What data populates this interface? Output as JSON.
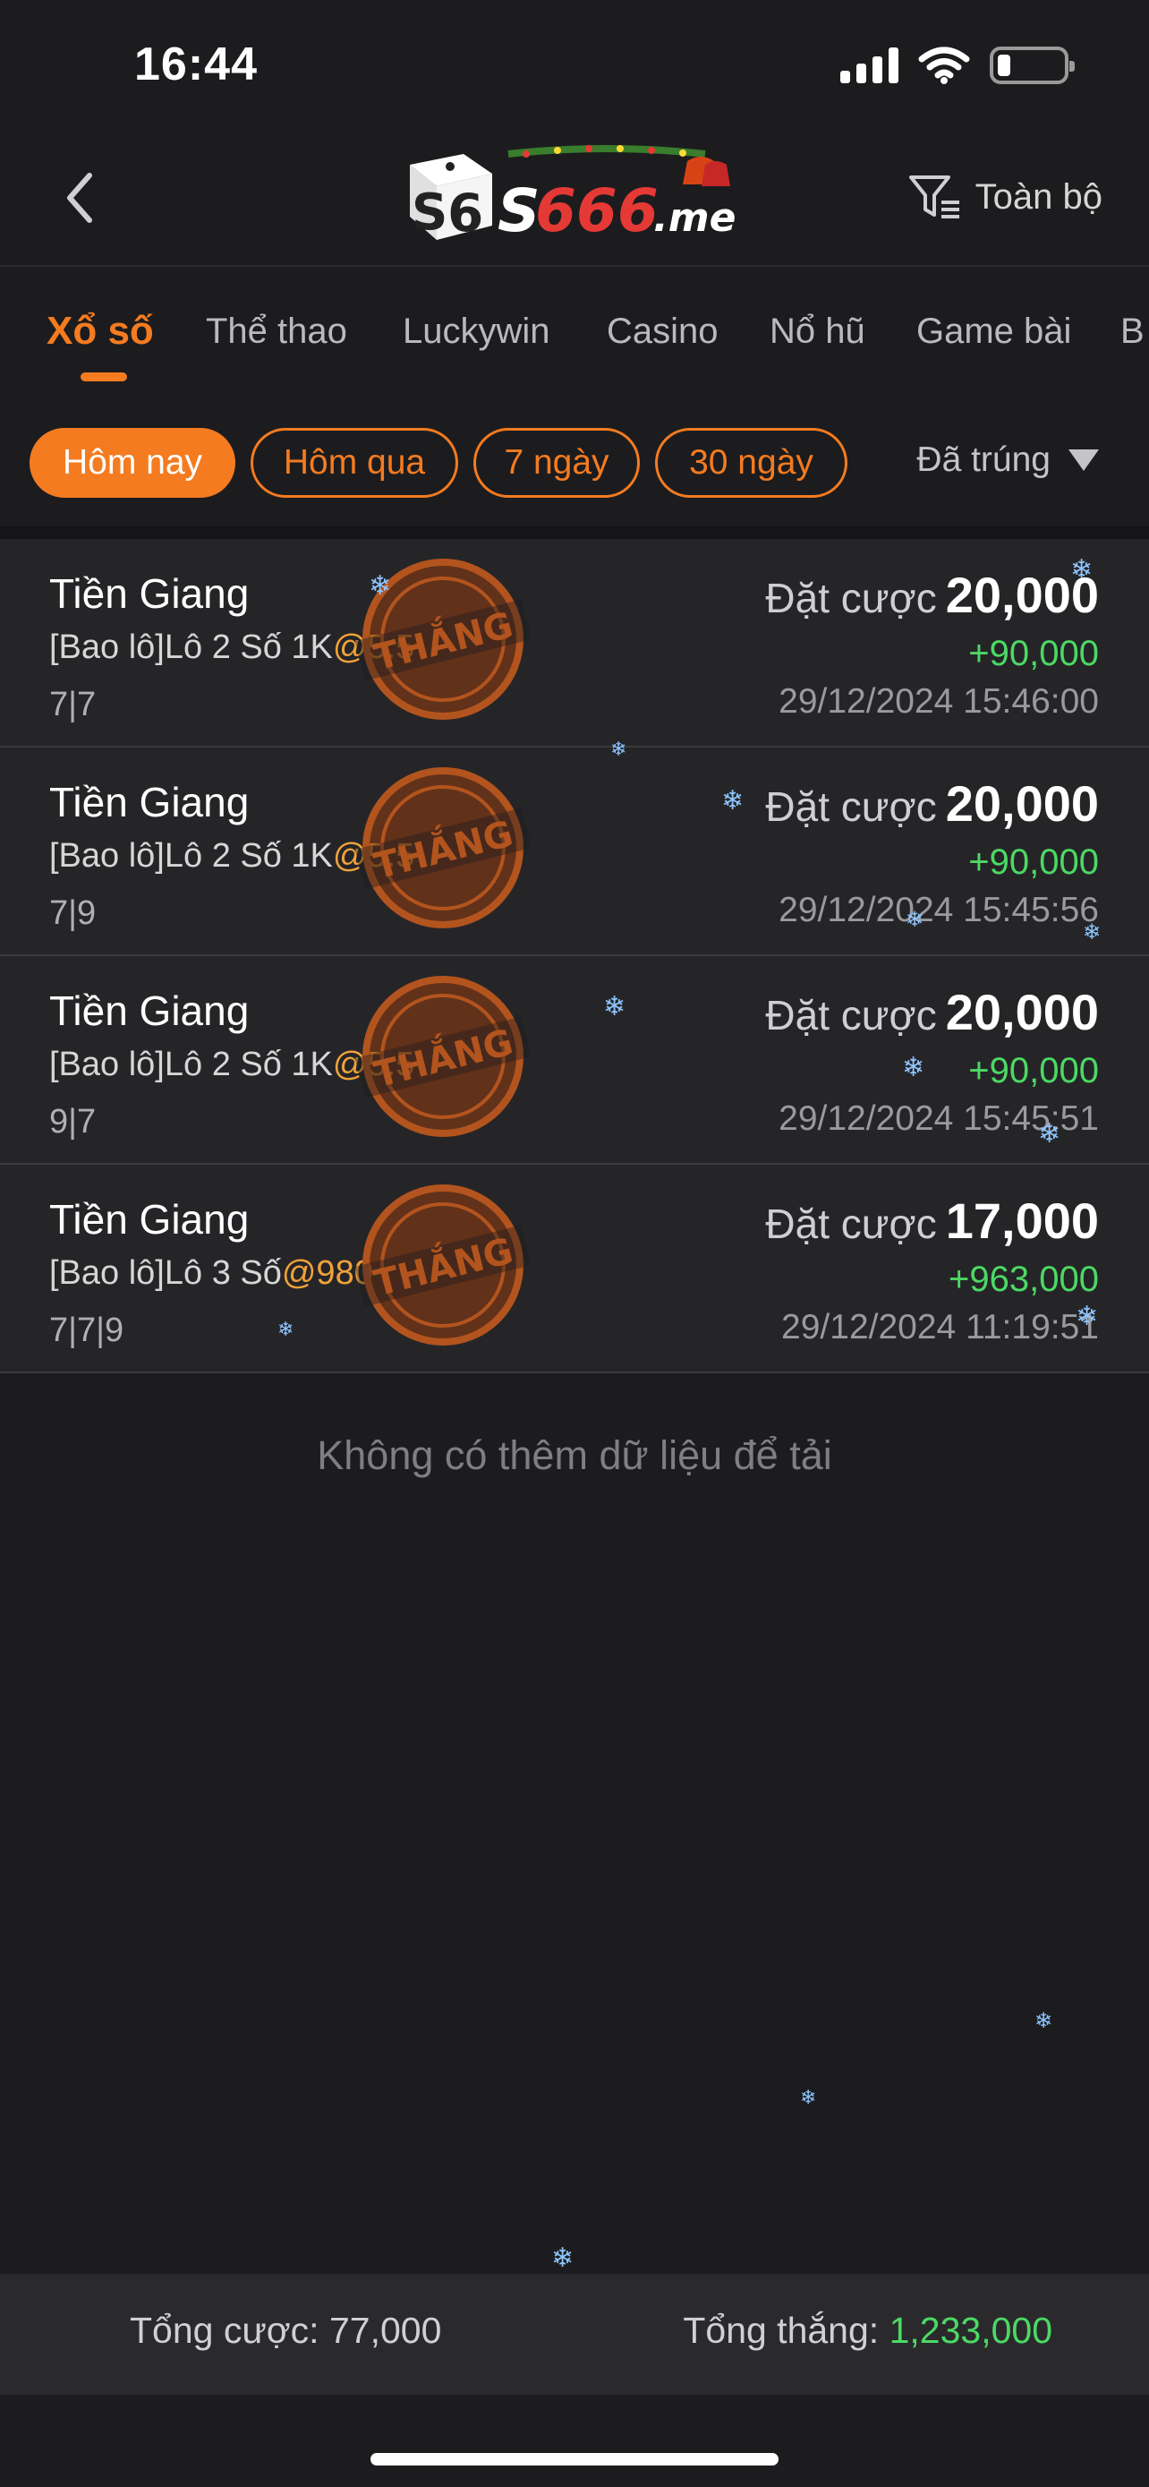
{
  "status_bar": {
    "time": "16:44"
  },
  "header": {
    "logo_text": "S666.me",
    "filter_label": "Toàn bộ"
  },
  "tabs": [
    {
      "label": "Xổ số",
      "active": true
    },
    {
      "label": "Thể thao",
      "active": false
    },
    {
      "label": "Luckywin",
      "active": false
    },
    {
      "label": "Casino",
      "active": false
    },
    {
      "label": "Nổ hũ",
      "active": false
    },
    {
      "label": "Game bài",
      "active": false
    },
    {
      "label": "B",
      "active": false
    }
  ],
  "date_filters": [
    {
      "label": "Hôm nay",
      "active": true
    },
    {
      "label": "Hôm qua",
      "active": false
    },
    {
      "label": "7 ngày",
      "active": false
    },
    {
      "label": "30 ngày",
      "active": false
    }
  ],
  "status_filter": {
    "label": "Đã trúng"
  },
  "stamp_text": "THẮNG",
  "bets": [
    {
      "title": "Tiền Giang",
      "desc": "[Bao lô]Lô 2 Số 1K",
      "odds": "@5.5",
      "numbers": "7|7",
      "bet_label": "Đặt cược",
      "amount": "20,000",
      "win": "+90,000",
      "time": "29/12/2024 15:46:00"
    },
    {
      "title": "Tiền Giang",
      "desc": "[Bao lô]Lô 2 Số 1K",
      "odds": "@5.5",
      "numbers": "7|9",
      "bet_label": "Đặt cược",
      "amount": "20,000",
      "win": "+90,000",
      "time": "29/12/2024 15:45:56"
    },
    {
      "title": "Tiền Giang",
      "desc": "[Bao lô]Lô 2 Số 1K",
      "odds": "@5.5",
      "numbers": "9|7",
      "bet_label": "Đặt cược",
      "amount": "20,000",
      "win": "+90,000",
      "time": "29/12/2024 15:45:51"
    },
    {
      "title": "Tiền Giang",
      "desc": "[Bao lô]Lô 3 Số",
      "odds": "@980",
      "numbers": "7|7|9",
      "bet_label": "Đặt cược",
      "amount": "17,000",
      "win": "+963,000",
      "time": "29/12/2024 11:19:51"
    }
  ],
  "no_more_text": "Không có thêm dữ liệu để tải",
  "footer": {
    "total_bet_label": "Tổng cược:",
    "total_bet_value": "77,000",
    "total_win_label": "Tổng thắng:",
    "total_win_value": "1,233,000"
  },
  "colors": {
    "accent": "#f47b20",
    "win_green": "#4cd964",
    "odds": "#f0a23a",
    "background": "#1c1c1e",
    "row": "#252528"
  }
}
